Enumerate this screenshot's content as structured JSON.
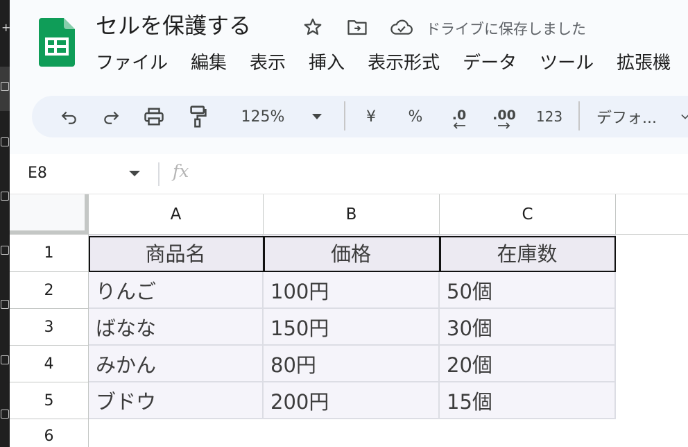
{
  "document": {
    "title": "セルを保護する",
    "save_status": "ドライブに保存しました"
  },
  "menu": [
    "ファイル",
    "編集",
    "表示",
    "挿入",
    "表示形式",
    "データ",
    "ツール",
    "拡張機"
  ],
  "toolbar": {
    "zoom": "125%",
    "currency": "¥",
    "percent": "%",
    "decrease_decimal": ".0",
    "increase_decimal": ".00",
    "number_format": "123",
    "font": "デフォ..."
  },
  "formula_bar": {
    "name_box": "E8",
    "fx": "fx"
  },
  "sheet": {
    "columns": [
      "A",
      "B",
      "C"
    ],
    "row_numbers": [
      "1",
      "2",
      "3",
      "4",
      "5",
      "6"
    ],
    "rows": [
      [
        "商品名",
        "価格",
        "在庫数"
      ],
      [
        "りんご",
        "100円",
        "50個"
      ],
      [
        "ばなな",
        "150円",
        "30個"
      ],
      [
        "みかん",
        "80円",
        "20個"
      ],
      [
        "ブドウ",
        "200円",
        "15個"
      ]
    ]
  },
  "colors": {
    "logo_green": "#0f9d58",
    "header_bg": "#f9fbfd",
    "toolbar_bg": "#edf2fa",
    "cell_fill": "#f5f4fa",
    "header_cell_fill": "#eceaf2"
  }
}
